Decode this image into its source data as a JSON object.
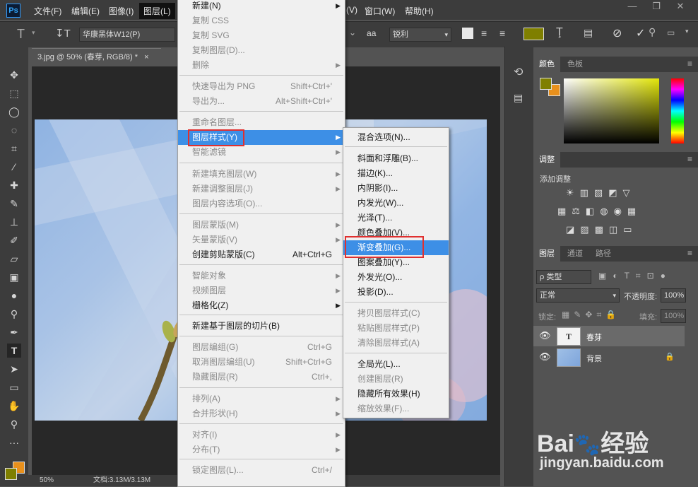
{
  "app": {
    "logo": "Ps"
  },
  "menubar": {
    "items": [
      "文件(F)",
      "编辑(E)",
      "图像(I)",
      "图层(L)",
      "(V)",
      "窗口(W)",
      "帮助(H)"
    ],
    "window_buttons": [
      "—",
      "❐",
      "✕"
    ]
  },
  "options": {
    "font_name": "华康黑体W12(P)",
    "aa_label": "a",
    "aa_mode": "锐利",
    "color": "#7f7f00"
  },
  "document": {
    "tab_title": "3.jpg @ 50% (春芽, RGB/8) *",
    "tab_close": "×",
    "zoom": "50%",
    "doc_info": "文档:3.13M/3.13M"
  },
  "layer_menu": {
    "items": [
      {
        "label": "新建(N)",
        "shortcut": "",
        "submenu": true,
        "disabled": false
      },
      {
        "label": "复制 CSS",
        "shortcut": "",
        "submenu": false,
        "disabled": true
      },
      {
        "label": "复制 SVG",
        "shortcut": "",
        "submenu": false,
        "disabled": true
      },
      {
        "label": "复制图层(D)...",
        "shortcut": "",
        "submenu": false,
        "disabled": true
      },
      {
        "label": "删除",
        "shortcut": "",
        "submenu": true,
        "disabled": true
      },
      {
        "label": "快速导出为 PNG",
        "shortcut": "Shift+Ctrl+'",
        "submenu": false,
        "disabled": true
      },
      {
        "label": "导出为...",
        "shortcut": "Alt+Shift+Ctrl+'",
        "submenu": false,
        "disabled": true
      },
      {
        "label": "重命名图层...",
        "shortcut": "",
        "submenu": false,
        "disabled": true
      },
      {
        "label": "图层样式(Y)",
        "shortcut": "",
        "submenu": true,
        "disabled": false
      },
      {
        "label": "智能滤镜",
        "shortcut": "",
        "submenu": true,
        "disabled": true
      },
      {
        "label": "新建填充图层(W)",
        "shortcut": "",
        "submenu": true,
        "disabled": true
      },
      {
        "label": "新建调整图层(J)",
        "shortcut": "",
        "submenu": true,
        "disabled": true
      },
      {
        "label": "图层内容选项(O)...",
        "shortcut": "",
        "submenu": false,
        "disabled": true
      },
      {
        "label": "图层蒙版(M)",
        "shortcut": "",
        "submenu": true,
        "disabled": true
      },
      {
        "label": "矢量蒙版(V)",
        "shortcut": "",
        "submenu": true,
        "disabled": true
      },
      {
        "label": "创建剪贴蒙版(C)",
        "shortcut": "Alt+Ctrl+G",
        "submenu": false,
        "disabled": false
      },
      {
        "label": "智能对象",
        "shortcut": "",
        "submenu": true,
        "disabled": true
      },
      {
        "label": "视频图层",
        "shortcut": "",
        "submenu": true,
        "disabled": true
      },
      {
        "label": "栅格化(Z)",
        "shortcut": "",
        "submenu": true,
        "disabled": false
      },
      {
        "label": "新建基于图层的切片(B)",
        "shortcut": "",
        "submenu": false,
        "disabled": false
      },
      {
        "label": "图层编组(G)",
        "shortcut": "Ctrl+G",
        "submenu": false,
        "disabled": true
      },
      {
        "label": "取消图层编组(U)",
        "shortcut": "Shift+Ctrl+G",
        "submenu": false,
        "disabled": true
      },
      {
        "label": "隐藏图层(R)",
        "shortcut": "Ctrl+,",
        "submenu": false,
        "disabled": true
      },
      {
        "label": "排列(A)",
        "shortcut": "",
        "submenu": true,
        "disabled": true
      },
      {
        "label": "合并形状(H)",
        "shortcut": "",
        "submenu": true,
        "disabled": true
      },
      {
        "label": "对齐(I)",
        "shortcut": "",
        "submenu": true,
        "disabled": true
      },
      {
        "label": "分布(T)",
        "shortcut": "",
        "submenu": true,
        "disabled": true
      },
      {
        "label": "锁定图层(L)...",
        "shortcut": "Ctrl+/",
        "submenu": false,
        "disabled": true
      }
    ]
  },
  "style_menu": {
    "items": [
      {
        "label": "混合选项(N)...",
        "disabled": false
      },
      {
        "label": "斜面和浮雕(B)...",
        "disabled": false
      },
      {
        "label": "描边(K)...",
        "disabled": false
      },
      {
        "label": "内阴影(I)...",
        "disabled": false
      },
      {
        "label": "内发光(W)...",
        "disabled": false
      },
      {
        "label": "光泽(T)...",
        "disabled": false
      },
      {
        "label": "颜色叠加(V)...",
        "disabled": false
      },
      {
        "label": "渐变叠加(G)...",
        "disabled": false
      },
      {
        "label": "图案叠加(Y)...",
        "disabled": false
      },
      {
        "label": "外发光(O)...",
        "disabled": false
      },
      {
        "label": "投影(D)...",
        "disabled": false
      },
      {
        "label": "拷贝图层样式(C)",
        "disabled": true
      },
      {
        "label": "粘贴图层样式(P)",
        "disabled": true
      },
      {
        "label": "清除图层样式(A)",
        "disabled": true
      },
      {
        "label": "全局光(L)...",
        "disabled": false
      },
      {
        "label": "创建图层(R)",
        "disabled": true
      },
      {
        "label": "隐藏所有效果(H)",
        "disabled": false
      },
      {
        "label": "缩放效果(F)...",
        "disabled": true
      }
    ]
  },
  "color_panel": {
    "tabs": [
      "颜色",
      "色板"
    ],
    "foreground": "#7f7f00",
    "background": "#e8901c"
  },
  "adjust_panel": {
    "tab": "调整",
    "title": "添加调整"
  },
  "layers_panel": {
    "tabs": [
      "图层",
      "通道",
      "路径"
    ],
    "filter_label": "ρ 类型",
    "blend_mode": "正常",
    "opacity_label": "不透明度:",
    "opacity_value": "100%",
    "lock_label": "锁定:",
    "fill_label": "填充:",
    "fill_value": "100%",
    "layers": [
      {
        "name": "春芽",
        "thumb": "T",
        "selected": true
      },
      {
        "name": "背景",
        "thumb": "",
        "selected": false
      }
    ]
  },
  "watermark": {
    "logo_text": "Bai",
    "logo_text2": "经验",
    "url": "jingyan.baidu.com"
  }
}
